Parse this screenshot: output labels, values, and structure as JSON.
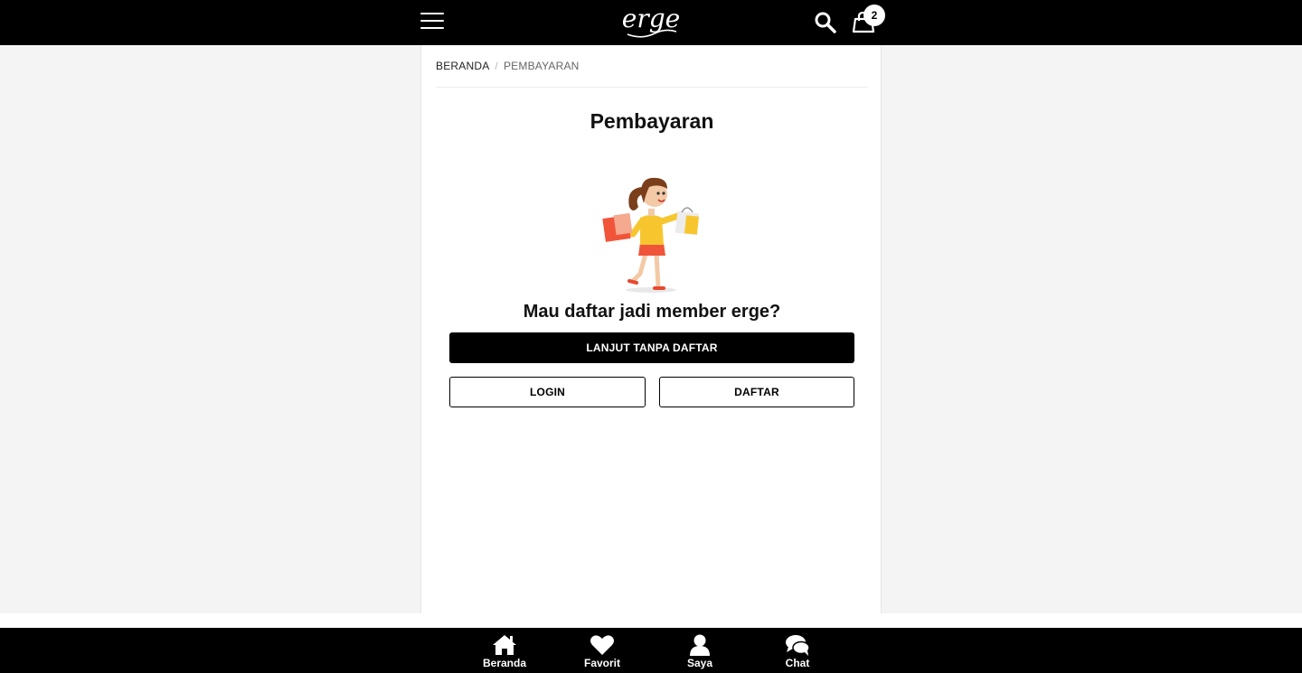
{
  "header": {
    "logo_text": "erge",
    "cart_count": "2",
    "icons": [
      "menu-icon",
      "search-icon",
      "shopping-bag-icon"
    ]
  },
  "breadcrumb": {
    "items": [
      "BERANDA",
      "PEMBAYARAN"
    ],
    "separator": "/"
  },
  "main": {
    "title": "Pembayaran",
    "question": "Mau daftar jadi member erge?",
    "continue_label": "LANJUT TANPA DAFTAR",
    "login_label": "LOGIN",
    "register_label": "DAFTAR"
  },
  "bottom_nav": {
    "items": [
      {
        "label": "Beranda",
        "icon": "home-icon"
      },
      {
        "label": "Favorit",
        "icon": "heart-icon"
      },
      {
        "label": "Saya",
        "icon": "user-icon"
      },
      {
        "label": "Chat",
        "icon": "chat-icon"
      }
    ]
  },
  "colors": {
    "bar": "#000000",
    "page_bg": "#f4f4f4",
    "panel_bg": "#ffffff"
  }
}
